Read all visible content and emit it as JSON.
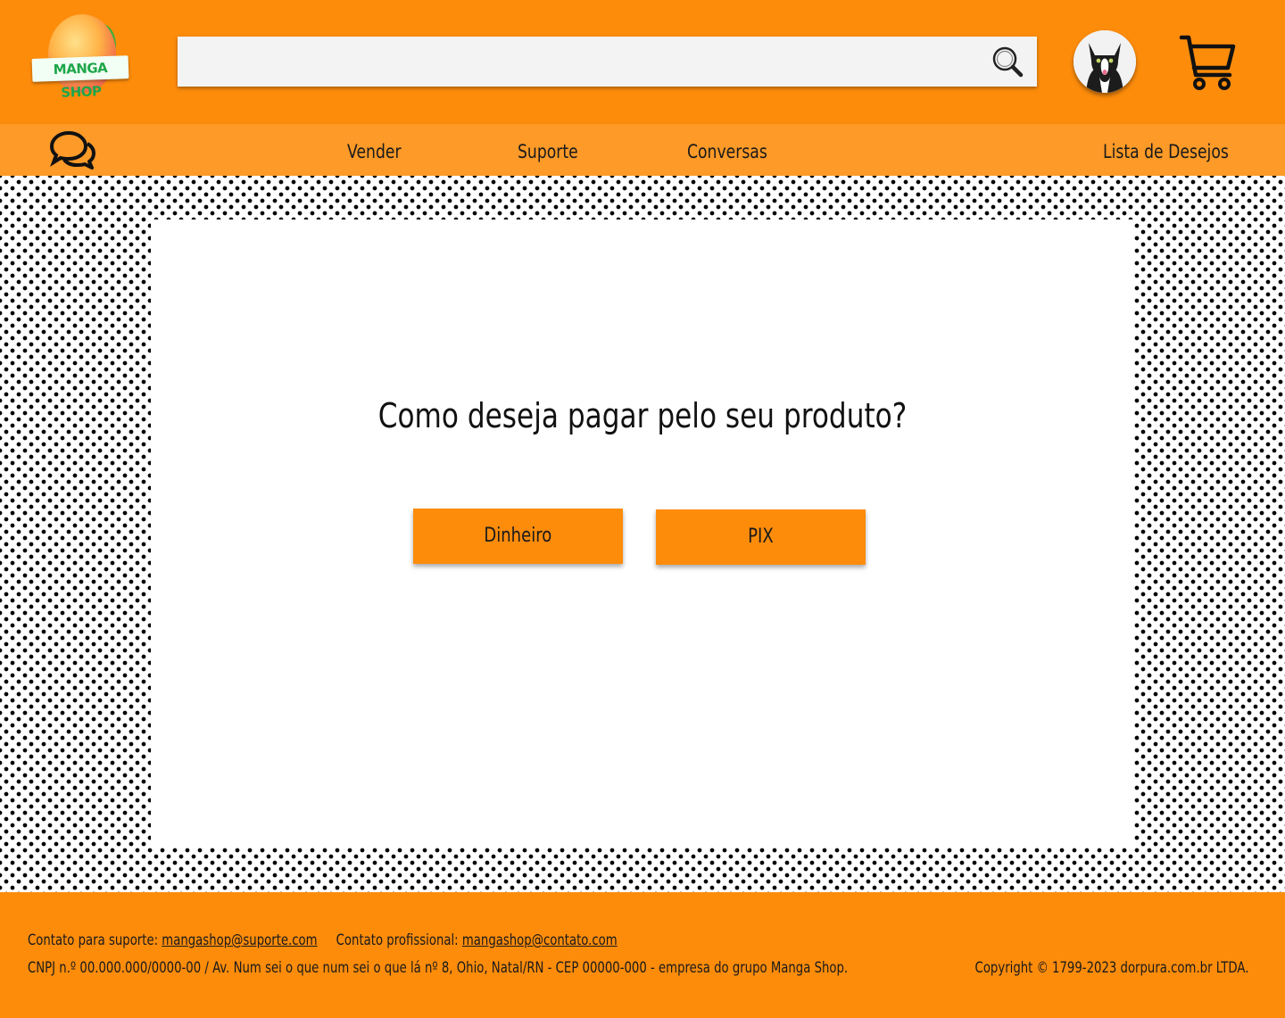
{
  "header": {
    "logo_text": "MANGA SHOP",
    "search": {
      "placeholder": "",
      "value": ""
    }
  },
  "nav": {
    "links": [
      "Vender",
      "Suporte",
      "Conversas",
      "Lista de Desejos"
    ]
  },
  "main": {
    "question": "Como deseja pagar pelo seu produto?",
    "buttons": [
      "Dinheiro",
      "PIX"
    ]
  },
  "footer": {
    "support_label": "Contato para suporte:",
    "support_email": "mangashop@suporte.com",
    "pro_label": "Contato profissional:",
    "pro_email": "mangashop@contato.com",
    "address": "CNPJ n.º 00.000.000/0000-00 / Av. Num sei o que num sei o que lá nº 8, Ohio, Natal/RN - CEP 00000-000 - empresa do grupo Manga Shop.",
    "copyright": "Copyright © 1799-2023 dorpura.com.br LTDA."
  },
  "colors": {
    "header_orange": "#fd8c0b",
    "nav_orange": "#fd9a28",
    "button_orange": "#fd8c0b",
    "logo_green": "#1ea64a"
  },
  "icons": [
    "mango-logo-icon",
    "search-icon",
    "cat-avatar-icon",
    "cart-icon",
    "chat-bubbles-icon"
  ]
}
